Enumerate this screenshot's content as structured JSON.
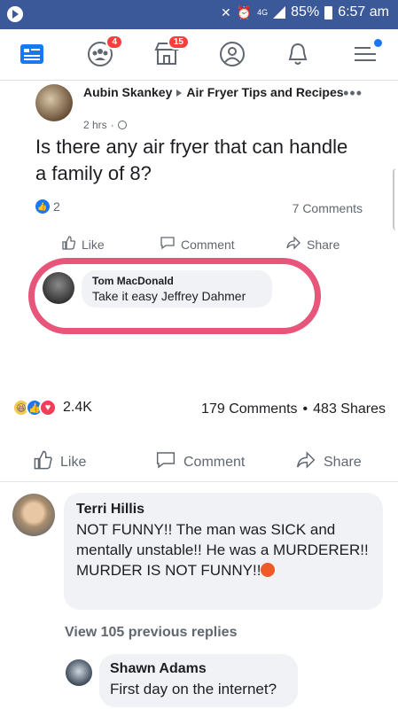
{
  "status_bar": {
    "network": "4G",
    "battery": "85%",
    "time": "6:57 am"
  },
  "nav": {
    "items": [
      {
        "icon": "feed-icon",
        "badge": ""
      },
      {
        "icon": "groups-icon",
        "badge": "4"
      },
      {
        "icon": "marketplace-icon",
        "badge": "15"
      },
      {
        "icon": "profile-icon",
        "badge": ""
      },
      {
        "icon": "notifications-icon",
        "badge": ""
      },
      {
        "icon": "menu-icon",
        "badge": ""
      }
    ],
    "accent_color": "#1877f2"
  },
  "shared_post": {
    "author": "Aubin Skankey",
    "group": "Air Fryer Tips and Recipes",
    "time": "2 hrs",
    "text": "Is there any air fryer that can handle a family of 8?",
    "reaction_count": "2",
    "comment_count": "7 Comments",
    "actions": {
      "like": "Like",
      "comment": "Comment",
      "share": "Share"
    },
    "highlighted_comment": {
      "author": "Tom MacDonald",
      "text": "Take it easy Jeffrey Dahmer"
    },
    "highlight_color": "#e8557a"
  },
  "post_footer": {
    "reaction_total": "2.4K",
    "comments": "179 Comments",
    "separator": "•",
    "shares": "483 Shares",
    "actions": {
      "like": "Like",
      "comment": "Comment",
      "share": "Share"
    }
  },
  "comments": [
    {
      "author": "Terri Hillis",
      "text": "NOT FUNNY!! The man was SICK and mentally unstable!! He was a MURDERER!! MURDER IS NOT FUNNY!!"
    }
  ],
  "view_replies": "View 105 previous replies",
  "reply": {
    "author": "Shawn Adams",
    "text": "First day on the internet?"
  }
}
